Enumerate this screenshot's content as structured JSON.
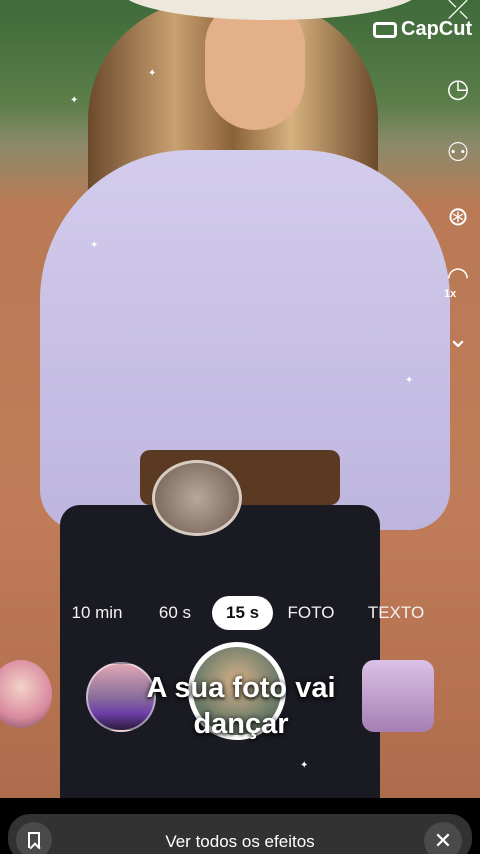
{
  "watermark": {
    "brand": "CapCut"
  },
  "right_rail": {
    "icons": [
      "flip-camera-icon",
      "timer-icon",
      "add-person-icon",
      "beauty-filters-icon",
      "speed-icon",
      "chevron-down-icon"
    ],
    "speed_label": "1x"
  },
  "modes": [
    "10 min",
    "60 s",
    "15 s",
    "FOTO",
    "TEXTO"
  ],
  "selected_mode": "15 s",
  "effect_caption": {
    "line1": "A sua foto vai",
    "line2": "dançar"
  },
  "bottom_bar": {
    "label": "Ver todos os efeitos"
  },
  "colors": {
    "selected_mode_bg": "#ffffff",
    "bottom_bar_bg": "#323232"
  }
}
